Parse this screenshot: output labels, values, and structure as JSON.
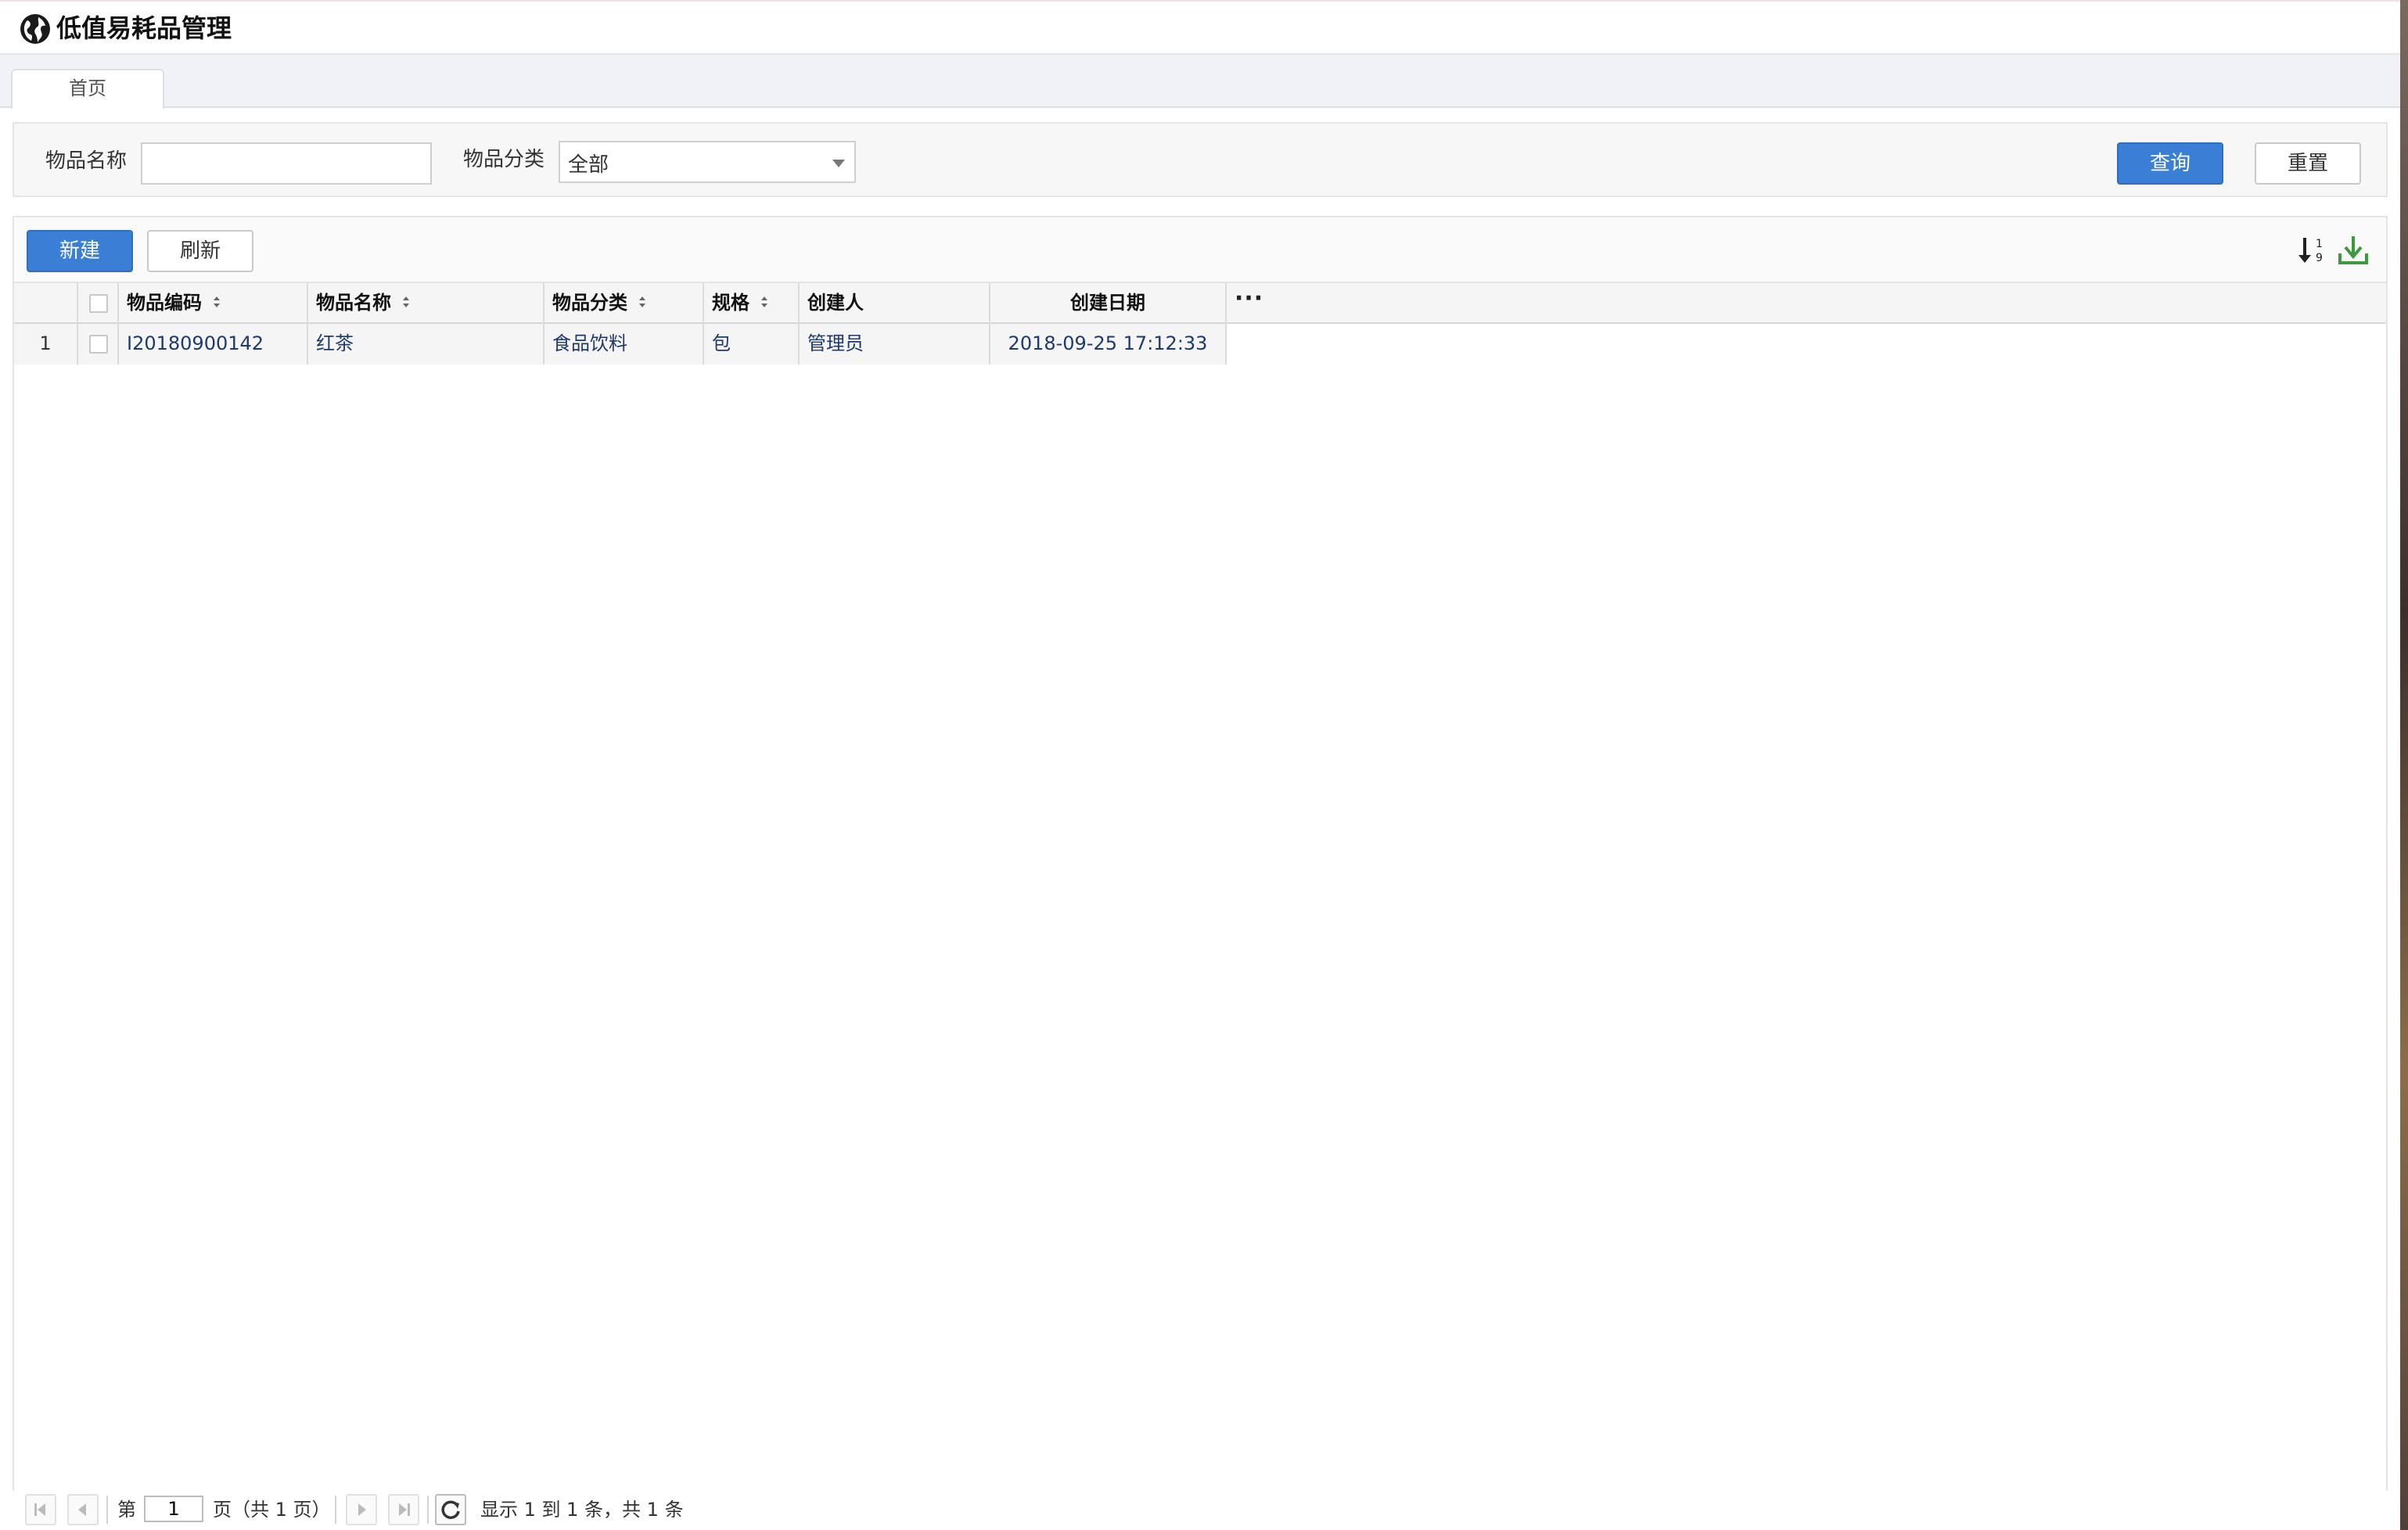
{
  "app": {
    "title": "低值易耗品管理",
    "logo_icon": "globe-icon"
  },
  "tabs": [
    {
      "label": "首页",
      "active": true
    }
  ],
  "search": {
    "name_label": "物品名称",
    "name_value": "",
    "category_label": "物品分类",
    "category_value": "全部",
    "query_button": "查询",
    "reset_button": "重置"
  },
  "toolbar": {
    "new_button": "新建",
    "refresh_button": "刷新",
    "sort_icon": "sort-numeric-icon",
    "export_icon": "download-icon"
  },
  "table": {
    "columns": [
      "物品编码",
      "物品名称",
      "物品分类",
      "规格",
      "创建人",
      "创建日期"
    ],
    "more_label": "···",
    "rows": [
      {
        "index": "1",
        "code": "I20180900142",
        "name": "红茶",
        "category": "食品饮料",
        "spec": "包",
        "creator": "管理员",
        "created": "2018-09-25 17:12:33"
      }
    ]
  },
  "pager": {
    "page_prefix": "第",
    "page_value": "1",
    "page_suffix": "页（共 1 页）",
    "summary": "显示 1 到 1 条，共 1 条"
  },
  "colors": {
    "primary": "#3a7fd5",
    "link_text": "#1d3a6e",
    "accent_export": "#3c9a3c"
  }
}
